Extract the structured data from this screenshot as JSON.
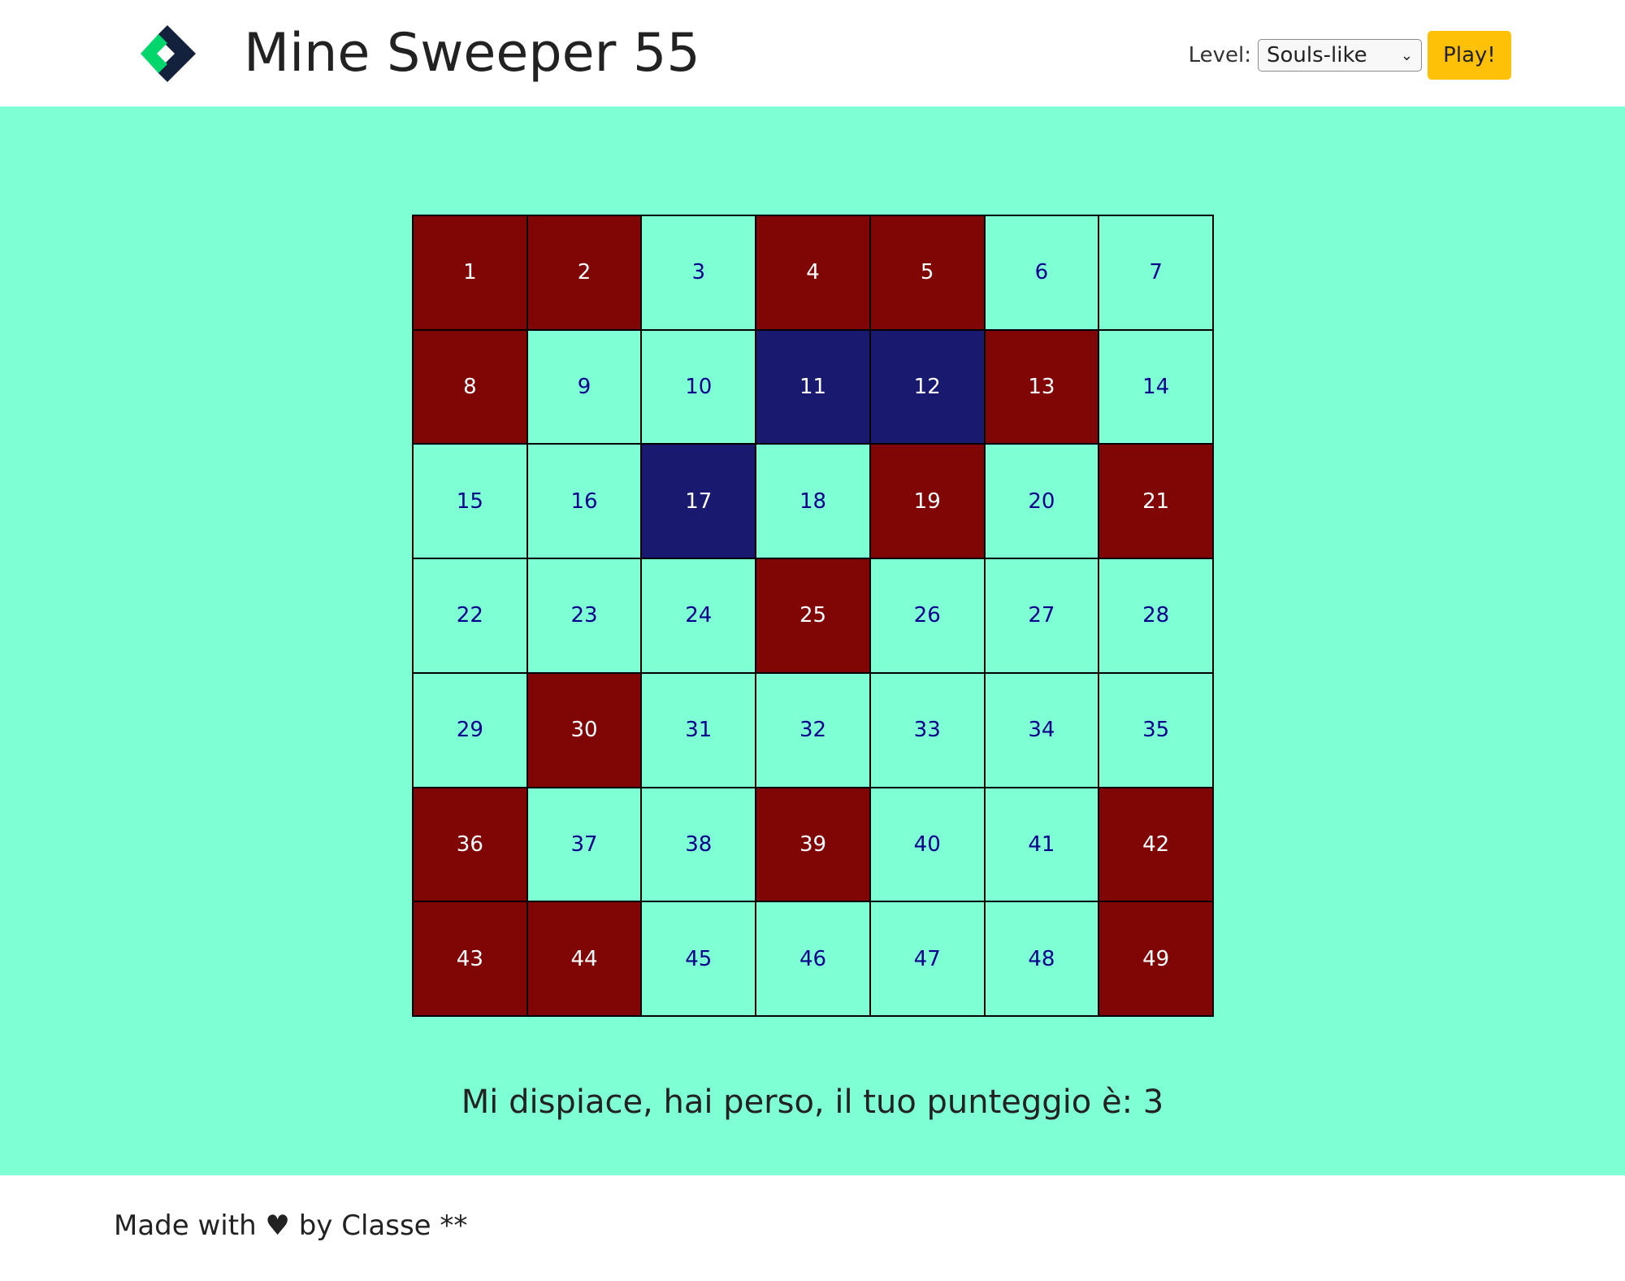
{
  "header": {
    "logo_icon": "diamond-logo-icon",
    "title": "Mine Sweeper 55",
    "level_label": "Level:",
    "level_selected": "Souls-like",
    "play_label": "Play!"
  },
  "colors": {
    "background": "#7fffd4",
    "bomb": "#800505",
    "clicked": "#191970",
    "play_button": "#ffc107"
  },
  "board": {
    "size": 7,
    "cells": [
      {
        "n": "1",
        "state": "bomb"
      },
      {
        "n": "2",
        "state": "bomb"
      },
      {
        "n": "3",
        "state": "safe"
      },
      {
        "n": "4",
        "state": "bomb"
      },
      {
        "n": "5",
        "state": "bomb"
      },
      {
        "n": "6",
        "state": "safe"
      },
      {
        "n": "7",
        "state": "safe"
      },
      {
        "n": "8",
        "state": "bomb"
      },
      {
        "n": "9",
        "state": "safe"
      },
      {
        "n": "10",
        "state": "safe"
      },
      {
        "n": "11",
        "state": "clicked"
      },
      {
        "n": "12",
        "state": "clicked"
      },
      {
        "n": "13",
        "state": "bomb"
      },
      {
        "n": "14",
        "state": "safe"
      },
      {
        "n": "15",
        "state": "safe"
      },
      {
        "n": "16",
        "state": "safe"
      },
      {
        "n": "17",
        "state": "clicked"
      },
      {
        "n": "18",
        "state": "safe"
      },
      {
        "n": "19",
        "state": "bomb"
      },
      {
        "n": "20",
        "state": "safe"
      },
      {
        "n": "21",
        "state": "bomb"
      },
      {
        "n": "22",
        "state": "safe"
      },
      {
        "n": "23",
        "state": "safe"
      },
      {
        "n": "24",
        "state": "safe"
      },
      {
        "n": "25",
        "state": "bomb"
      },
      {
        "n": "26",
        "state": "safe"
      },
      {
        "n": "27",
        "state": "safe"
      },
      {
        "n": "28",
        "state": "safe"
      },
      {
        "n": "29",
        "state": "safe"
      },
      {
        "n": "30",
        "state": "bomb"
      },
      {
        "n": "31",
        "state": "safe"
      },
      {
        "n": "32",
        "state": "safe"
      },
      {
        "n": "33",
        "state": "safe"
      },
      {
        "n": "34",
        "state": "safe"
      },
      {
        "n": "35",
        "state": "safe"
      },
      {
        "n": "36",
        "state": "bomb"
      },
      {
        "n": "37",
        "state": "safe"
      },
      {
        "n": "38",
        "state": "safe"
      },
      {
        "n": "39",
        "state": "bomb"
      },
      {
        "n": "40",
        "state": "safe"
      },
      {
        "n": "41",
        "state": "safe"
      },
      {
        "n": "42",
        "state": "bomb"
      },
      {
        "n": "43",
        "state": "bomb"
      },
      {
        "n": "44",
        "state": "bomb"
      },
      {
        "n": "45",
        "state": "safe"
      },
      {
        "n": "46",
        "state": "safe"
      },
      {
        "n": "47",
        "state": "safe"
      },
      {
        "n": "48",
        "state": "safe"
      },
      {
        "n": "49",
        "state": "bomb"
      }
    ]
  },
  "result_message": "Mi dispiace, hai perso, il tuo punteggio è: 3",
  "footer": {
    "text": "Made with ♥ by Classe **"
  }
}
